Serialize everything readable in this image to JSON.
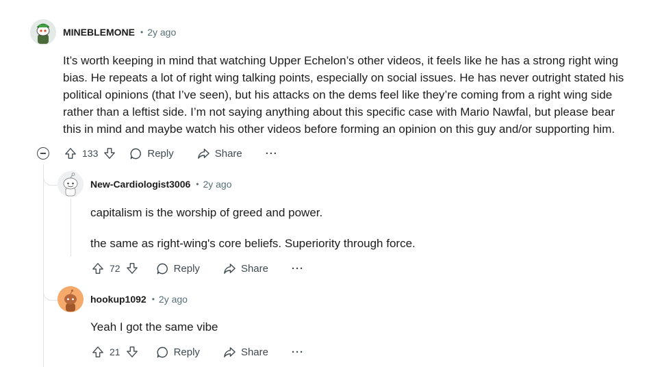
{
  "comments": [
    {
      "author": "MINEBLEMONE",
      "separator": "•",
      "time": "2y ago",
      "body_lines": [
        "It’s worth keeping in mind that watching Upper Echelon’s other videos, it feels like he has a strong right wing",
        "bias. He repeats a lot of right wing talking points, especially on social issues. He has never outright stated his",
        "political opinions (that I’ve seen), but his attacks on the dems feel like they’re coming from a right wing side",
        "rather than a leftist side. I’m not saying anything about this specific case with Mario Nawfal, but please bear",
        "this in mind and maybe watch his other videos before forming an opinion on this guy and/or supporting him."
      ],
      "score": "133",
      "reply_label": "Reply",
      "share_label": "Share",
      "more_label": "···"
    },
    {
      "author": "New-Cardiologist3006",
      "separator": "•",
      "time": "2y ago",
      "body_paragraphs": [
        "capitalism is the worship of greed and power.",
        "the same as right-wing's core beliefs. Superiority through force."
      ],
      "score": "72",
      "reply_label": "Reply",
      "share_label": "Share",
      "more_label": "···"
    },
    {
      "author": "hookup1092",
      "separator": "•",
      "time": "2y ago",
      "body_paragraphs": [
        "Yeah I got the same vibe"
      ],
      "score": "21",
      "reply_label": "Reply",
      "share_label": "Share",
      "more_label": "···"
    }
  ],
  "colors": {
    "thread_line": "#dfe1e3",
    "meta_gray": "#576f76",
    "action_gray": "#3e4a4f",
    "hookup_avatar": "#f5a96a"
  }
}
